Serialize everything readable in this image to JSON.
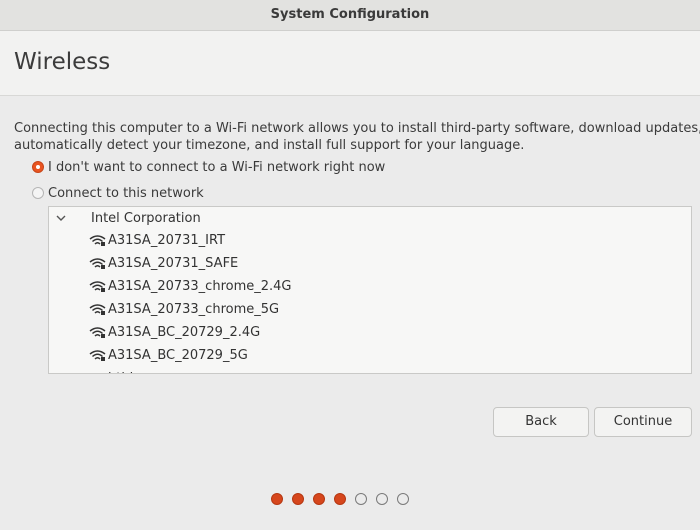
{
  "window": {
    "title": "System Configuration"
  },
  "page": {
    "title": "Wireless"
  },
  "description": {
    "line1": "Connecting this computer to a Wi-Fi network allows you to install third-party software, download updates,",
    "line2": "automatically detect your timezone, and install full support for your language."
  },
  "options": [
    {
      "label": "I don't want to connect to a Wi-Fi network right now",
      "selected": true
    },
    {
      "label": "Connect to this network",
      "selected": false
    }
  ],
  "network_group": {
    "label": "Intel Corporation",
    "expanded": true
  },
  "networks": [
    {
      "ssid": "A31SA_20731_IRT"
    },
    {
      "ssid": "A31SA_20731_SAFE"
    },
    {
      "ssid": "A31SA_20733_chrome_2.4G"
    },
    {
      "ssid": "A31SA_20733_chrome_5G"
    },
    {
      "ssid": "A31SA_BC_20729_2.4G"
    },
    {
      "ssid": "A31SA_BC_20729_5G"
    },
    {
      "ssid": "hthi"
    }
  ],
  "buttons": {
    "back": "Back",
    "continue": "Continue"
  },
  "progress": {
    "total_steps": 7,
    "completed_steps": 4
  },
  "colors": {
    "accent": "#e95420",
    "dot_filled": "#d6461c"
  }
}
